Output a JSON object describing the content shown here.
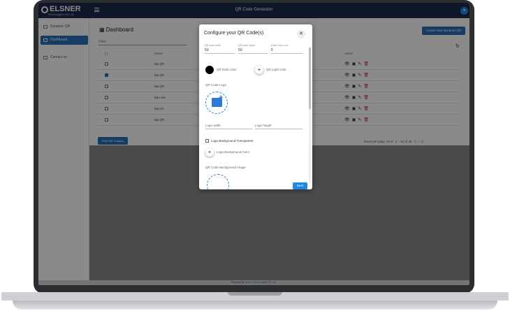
{
  "app": {
    "logo_text": "ELSNER",
    "logo_sub": "Technologies Pvt Ltd.",
    "title": "QR Code Generator",
    "avatar_icon": "user-icon"
  },
  "sidebar": {
    "items": [
      {
        "label": "Dynamic QR",
        "icon": "qr-icon"
      },
      {
        "label": "Dashboard",
        "icon": "grid-icon"
      },
      {
        "label": "Contact us",
        "icon": "contact-icon"
      }
    ]
  },
  "dashboard": {
    "title": "Dashboard",
    "filter_placeholder": "Filter",
    "create_button": "Create New Dynamic QR",
    "columns": [
      "Name",
      "Action"
    ],
    "rows": [
      {
        "name": "My QR",
        "checked": false
      },
      {
        "name": "My QR",
        "checked": true
      },
      {
        "name": "My QR",
        "checked": false
      },
      {
        "name": "My Last",
        "checked": false
      },
      {
        "name": "My Url",
        "checked": false
      },
      {
        "name": "My QR",
        "checked": false
      }
    ],
    "print_button": "Print QR Code(s)",
    "items_per_page_label": "Items per page:",
    "items_per_page_value": "10",
    "range": "1 – 10 of 46"
  },
  "modal": {
    "title": "Configure your QR Code(s)",
    "fields": {
      "qr_width_label": "QR code width",
      "qr_width_value": "50",
      "qr_height_label": "QR code height",
      "qr_height_value": "50",
      "quiet_zone_label": "Quiet Zone size",
      "quiet_zone_value": "5"
    },
    "dark_color_label": "QR Dark color",
    "light_color_label": "QR Light color",
    "qr_code_logo_label": "QR Code Logo",
    "logo_width_label": "Logo width",
    "logo_height_label": "Logo height",
    "logo_bg_transparent_label": "Logo Background Transparent",
    "logo_bg_color_label": "Logo Background Color",
    "bg_image_label": "QR Code Background Image",
    "next_button": "Next",
    "dark_color": "#000000"
  },
  "footer": {
    "text": "Powered By ",
    "link": "Elsner Technologies Pvt. Ltd."
  }
}
